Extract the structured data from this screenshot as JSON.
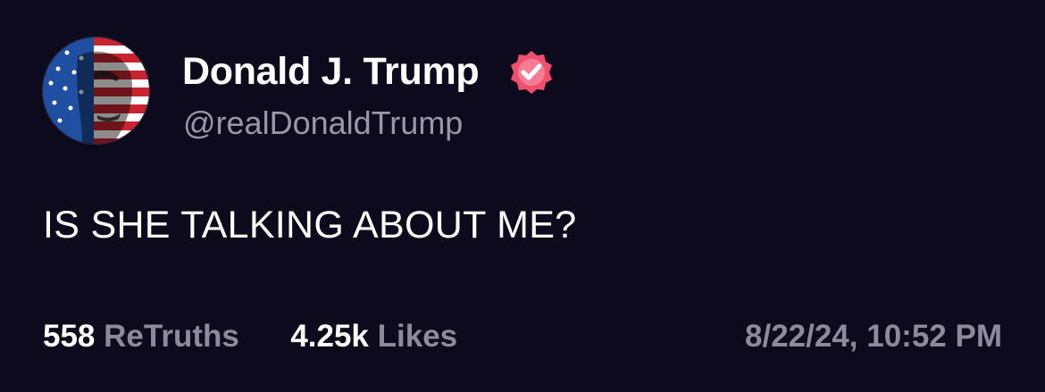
{
  "post": {
    "author": {
      "display_name": "Donald J. Trump",
      "handle": "@realDonaldTrump",
      "avatar_icon": "flag-portrait-avatar",
      "verified_icon": "verified-badge-icon",
      "verified_color": "#f0506e"
    },
    "text": "IS SHE TALKING ABOUT ME?",
    "stats": {
      "retruths_count": "558",
      "retruths_label": "ReTruths",
      "likes_count": "4.25k",
      "likes_label": "Likes"
    },
    "timestamp": "8/22/24, 10:52 PM"
  },
  "colors": {
    "background": "#0c0a1c",
    "text_primary": "#ffffff",
    "text_secondary": "#8d8b9a"
  }
}
